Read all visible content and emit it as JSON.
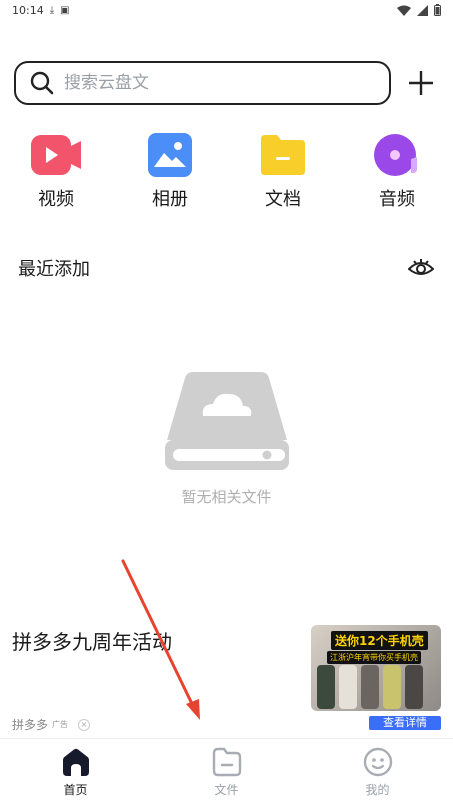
{
  "status_bar": {
    "time": "10:14"
  },
  "search": {
    "placeholder": "搜索云盘文"
  },
  "categories": [
    {
      "label": "视频",
      "icon": "video-icon",
      "color": "#f2556b"
    },
    {
      "label": "相册",
      "icon": "photo-icon",
      "color": "#4b8ef7"
    },
    {
      "label": "文档",
      "icon": "folder-icon",
      "color": "#f8cf2a"
    },
    {
      "label": "音频",
      "icon": "music-icon",
      "color": "#9b48e8"
    }
  ],
  "recent": {
    "title": "最近添加",
    "empty_text": "暂无相关文件"
  },
  "ad": {
    "title": "拼多多九周年活动",
    "source": "拼多多",
    "badge": "广告",
    "close": "×",
    "thumb_caption_main": "送你12个手机壳",
    "thumb_caption_sub": "江浙沪年宵带你买手机壳",
    "cta": "查看详情"
  },
  "tabs": [
    {
      "label": "首页",
      "icon": "home-icon",
      "active": true
    },
    {
      "label": "文件",
      "icon": "file-folder-icon",
      "active": false
    },
    {
      "label": "我的",
      "icon": "smiley-icon",
      "active": false
    }
  ],
  "colors": {
    "accent": "#3b6ef6",
    "arrow": "#e8432f",
    "empty_icon": "#cfcfcf"
  }
}
